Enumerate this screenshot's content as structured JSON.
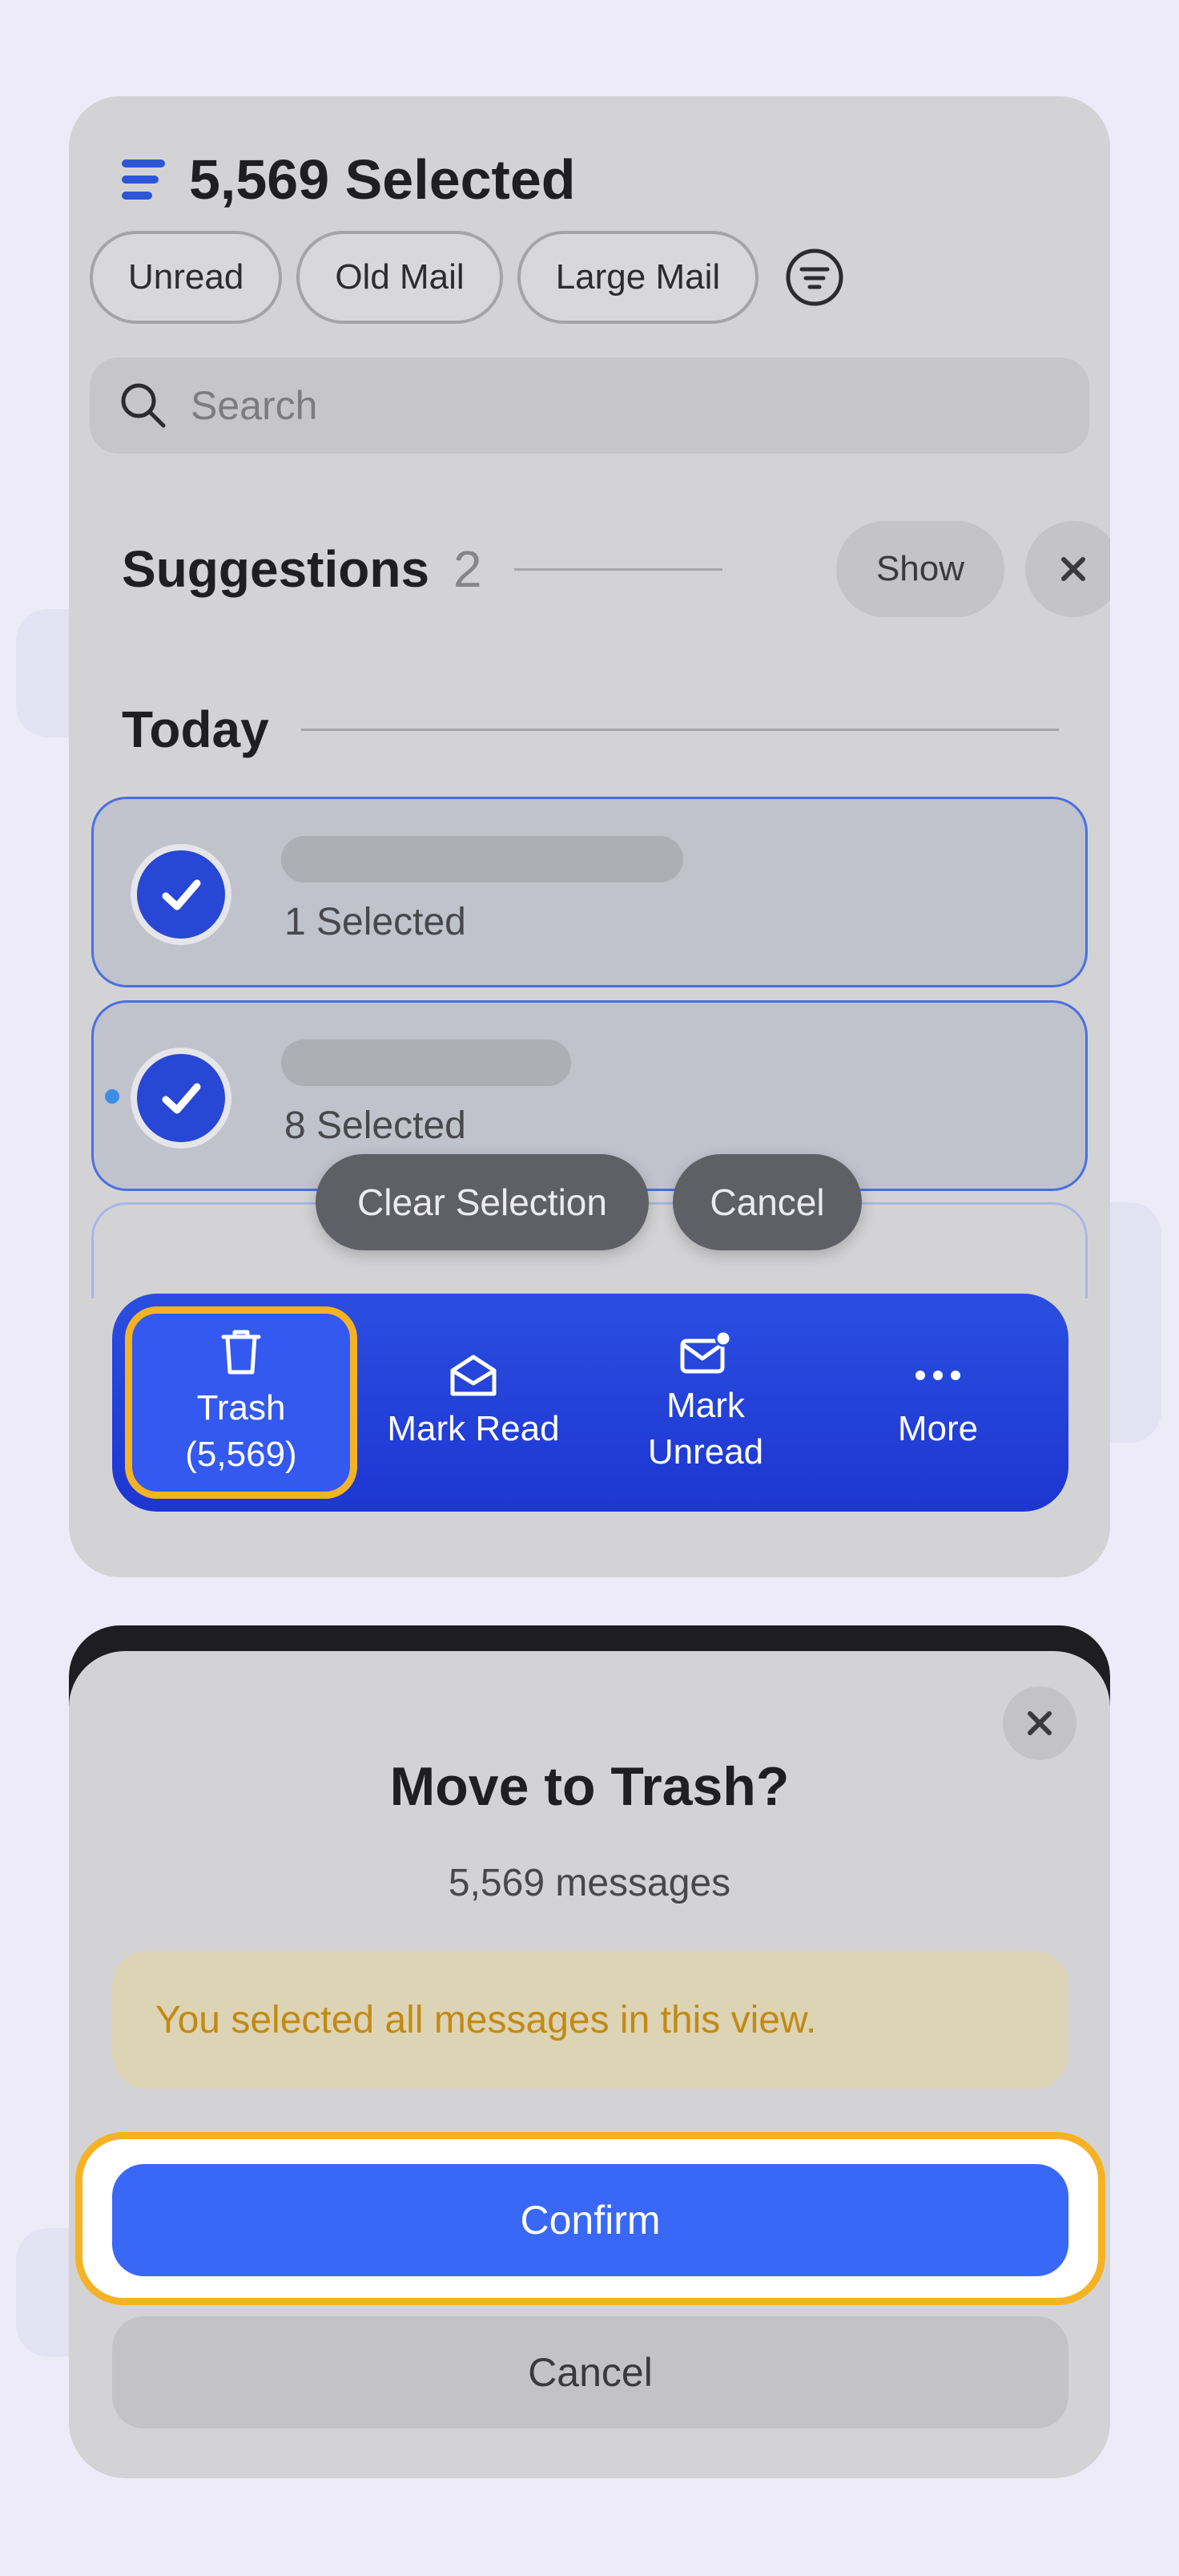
{
  "header": {
    "title": "5,569 Selected"
  },
  "filters": [
    "Unread",
    "Old Mail",
    "Large Mail"
  ],
  "search": {
    "placeholder": "Search"
  },
  "suggestions": {
    "title": "Suggestions",
    "count": "2",
    "show_label": "Show"
  },
  "section": {
    "today": "Today"
  },
  "threads": [
    {
      "selected_text": "1 Selected"
    },
    {
      "selected_text": "8 Selected"
    }
  ],
  "selection_pills": {
    "clear": "Clear Selection",
    "cancel": "Cancel"
  },
  "actions": {
    "trash_line1": "Trash",
    "trash_line2": "(5,569)",
    "mark_read": "Mark Read",
    "mark_unread_line1": "Mark",
    "mark_unread_line2": "Unread",
    "more": "More"
  },
  "dialog": {
    "title": "Move to Trash?",
    "subtitle": "5,569 messages",
    "warning": "You selected all messages in this view.",
    "confirm": "Confirm",
    "cancel": "Cancel"
  },
  "colors": {
    "accent": "#2747d4",
    "confirm": "#3a68f6",
    "highlight": "#f5b324",
    "warning_text": "#c28a14"
  }
}
